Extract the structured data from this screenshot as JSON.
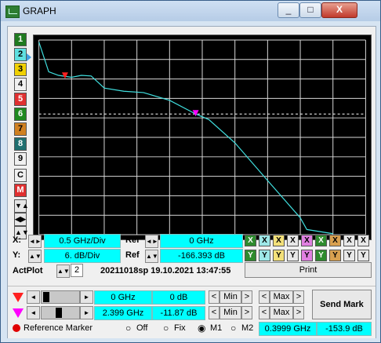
{
  "window": {
    "title": "GRAPH",
    "controls": [
      "_",
      "□",
      "X"
    ]
  },
  "traces": {
    "labels": [
      "1",
      "2",
      "3",
      "4",
      "5",
      "6",
      "7",
      "8",
      "9",
      "C",
      "M"
    ],
    "colors": [
      "#40c040",
      "#00e0e0",
      "#f0d000",
      "#f000f0",
      "#e03030",
      "#00b000",
      "#c08020",
      "#00c0c0",
      "#c0c0c0",
      "#e8e8e8",
      "#ff3030"
    ],
    "active": "2"
  },
  "chart_data": {
    "type": "line",
    "x_range": [
      0,
      5
    ],
    "y_range": [
      -224,
      -164
    ],
    "x_div": "0.5 GHz/Div",
    "y_div": "6. dB/Div",
    "grid": true,
    "x": [
      0.0,
      0.15,
      0.3,
      0.5,
      0.65,
      0.8,
      1.0,
      1.3,
      1.6,
      2.0,
      2.4,
      2.6,
      3.0,
      3.5,
      4.0,
      4.1,
      4.5
    ],
    "series": [
      {
        "values": [
          -164.6,
          -173.8,
          -174.9,
          -175.5,
          -174.9,
          -175.1,
          -178.8,
          -179.8,
          -180.2,
          -182.6,
          -186.8,
          -188.5,
          -195.7,
          -207.3,
          -218.8,
          -222.4,
          -223.7
        ],
        "color": "#40e0e0"
      }
    ],
    "ref_line": -186.8,
    "markers": [
      {
        "name": "M1",
        "x": 0.3999,
        "y": -153.9,
        "color": "#ff2020",
        "plot_y": -175.2
      },
      {
        "name": "M2",
        "x": 2.399,
        "y": -186.8,
        "color": "#ff00ff",
        "plot_y": -186.8
      }
    ]
  },
  "scale": {
    "x_label": "X:",
    "x_value": "0.5  GHz/Div",
    "ref_x_label": "Ref",
    "ref_x_value": "0  GHz",
    "y_label": "Y:",
    "y_value": "6.  dB/Div",
    "ref_y_label": "Ref",
    "ref_y_value": "-166.393  dB",
    "actplot_label": "ActPlot",
    "actplot_value": "2",
    "file_info": "20211018sp 19.10.2021 13:47:55",
    "print_label": "Print"
  },
  "xy_buttons": {
    "x": [
      "X",
      "X",
      "X",
      "X",
      "X",
      "X",
      "X",
      "X",
      "X"
    ],
    "y": [
      "Y",
      "Y",
      "Y",
      "Y",
      "Y",
      "Y",
      "Y",
      "Y",
      "Y"
    ],
    "colors": [
      "#40c040",
      "#00e0e0",
      "#f0d000",
      "#f000f0",
      "#e03030",
      "#00b000",
      "#c08020",
      "#00c0c0",
      "#c0c0c0"
    ]
  },
  "markers_panel": {
    "m1_freq": "0 GHz",
    "m1_db": "0 dB",
    "m2_freq": "2.399 GHz",
    "m2_db": "-11.87 dB",
    "lt": "<",
    "min": "Min",
    "gt": ">",
    "lt2": "<",
    "max": "Max",
    "gt2": ">",
    "send_mark": "Send Mark",
    "reference_marker": "Reference Marker",
    "off": "Off",
    "fix": "Fix",
    "m1": "M1",
    "m2": "M2",
    "ref_freq": "0.3999 GHz",
    "ref_db": "-153.9 dB"
  }
}
